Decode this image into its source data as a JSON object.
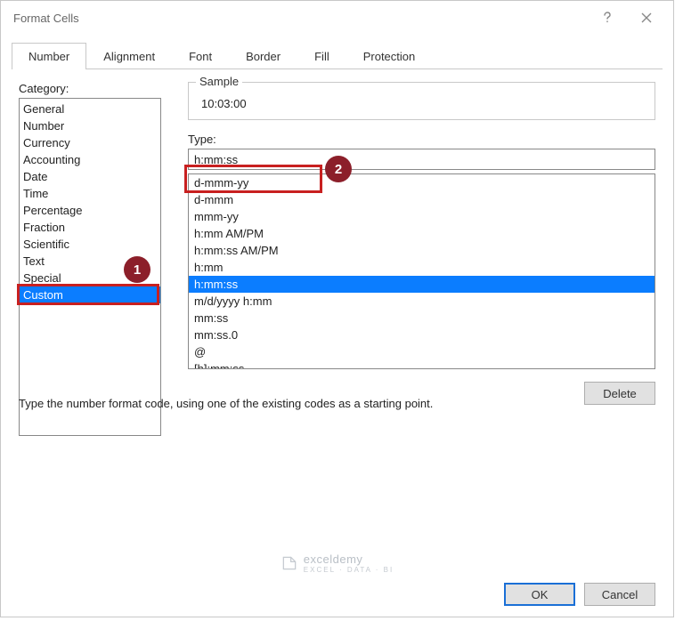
{
  "window": {
    "title": "Format Cells"
  },
  "tabs": {
    "items": [
      "Number",
      "Alignment",
      "Font",
      "Border",
      "Fill",
      "Protection"
    ],
    "active_index": 0
  },
  "category": {
    "label": "Category:",
    "items": [
      "General",
      "Number",
      "Currency",
      "Accounting",
      "Date",
      "Time",
      "Percentage",
      "Fraction",
      "Scientific",
      "Text",
      "Special",
      "Custom"
    ],
    "selected_index": 11
  },
  "sample": {
    "label": "Sample",
    "value": "10:03:00"
  },
  "type": {
    "label": "Type:",
    "value": "h:mm:ss",
    "options": [
      "d-mmm-yy",
      "d-mmm",
      "mmm-yy",
      "h:mm AM/PM",
      "h:mm:ss AM/PM",
      "h:mm",
      "h:mm:ss",
      "m/d/yyyy h:mm",
      "mm:ss",
      "mm:ss.0",
      "@",
      "[h]:mm:ss"
    ],
    "selected_index": 6
  },
  "buttons": {
    "delete": "Delete",
    "ok": "OK",
    "cancel": "Cancel"
  },
  "description": "Type the number format code, using one of the existing codes as a starting point.",
  "callouts": {
    "badge1": "1",
    "badge2": "2"
  },
  "watermark": {
    "brand": "exceldemy",
    "tagline": "EXCEL · DATA · BI"
  }
}
